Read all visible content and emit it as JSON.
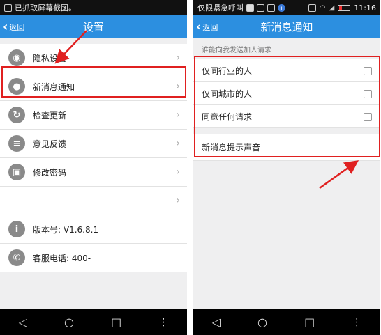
{
  "left": {
    "status_text": "已抓取屏幕截图。",
    "back_label": "返回",
    "title": "设置",
    "items": [
      {
        "label": "隐私设置",
        "icon": "eye-icon",
        "glyph": "◉"
      },
      {
        "label": "新消息通知",
        "icon": "bubble-icon",
        "glyph": "●"
      },
      {
        "label": "检查更新",
        "icon": "refresh-icon",
        "glyph": "↻"
      },
      {
        "label": "意见反馈",
        "icon": "chat-icon",
        "glyph": "≡"
      },
      {
        "label": "修改密码",
        "icon": "lock-icon",
        "glyph": "▣"
      },
      {
        "label": "",
        "icon": "",
        "glyph": ""
      }
    ],
    "version": "版本号: V1.6.8.1",
    "service": "客服电话: 400-",
    "version_glyph": "i",
    "service_glyph": "✆"
  },
  "right": {
    "status_text": "仅限紧急呼叫",
    "time": "11:16",
    "back_label": "返回",
    "title": "新消息通知",
    "section_caption": "谁能向我发送加人请求",
    "options": [
      {
        "label": "仅同行业的人",
        "checked": false
      },
      {
        "label": "仅同城市的人",
        "checked": false
      },
      {
        "label": "同意任何请求",
        "checked": false
      }
    ],
    "sound_label": "新消息提示声音"
  },
  "nav": {
    "back": "◁",
    "home": "○",
    "recent": "□",
    "more": "⋮"
  },
  "annotation_color": "#e02020",
  "brand_color": "#2c8fe0"
}
